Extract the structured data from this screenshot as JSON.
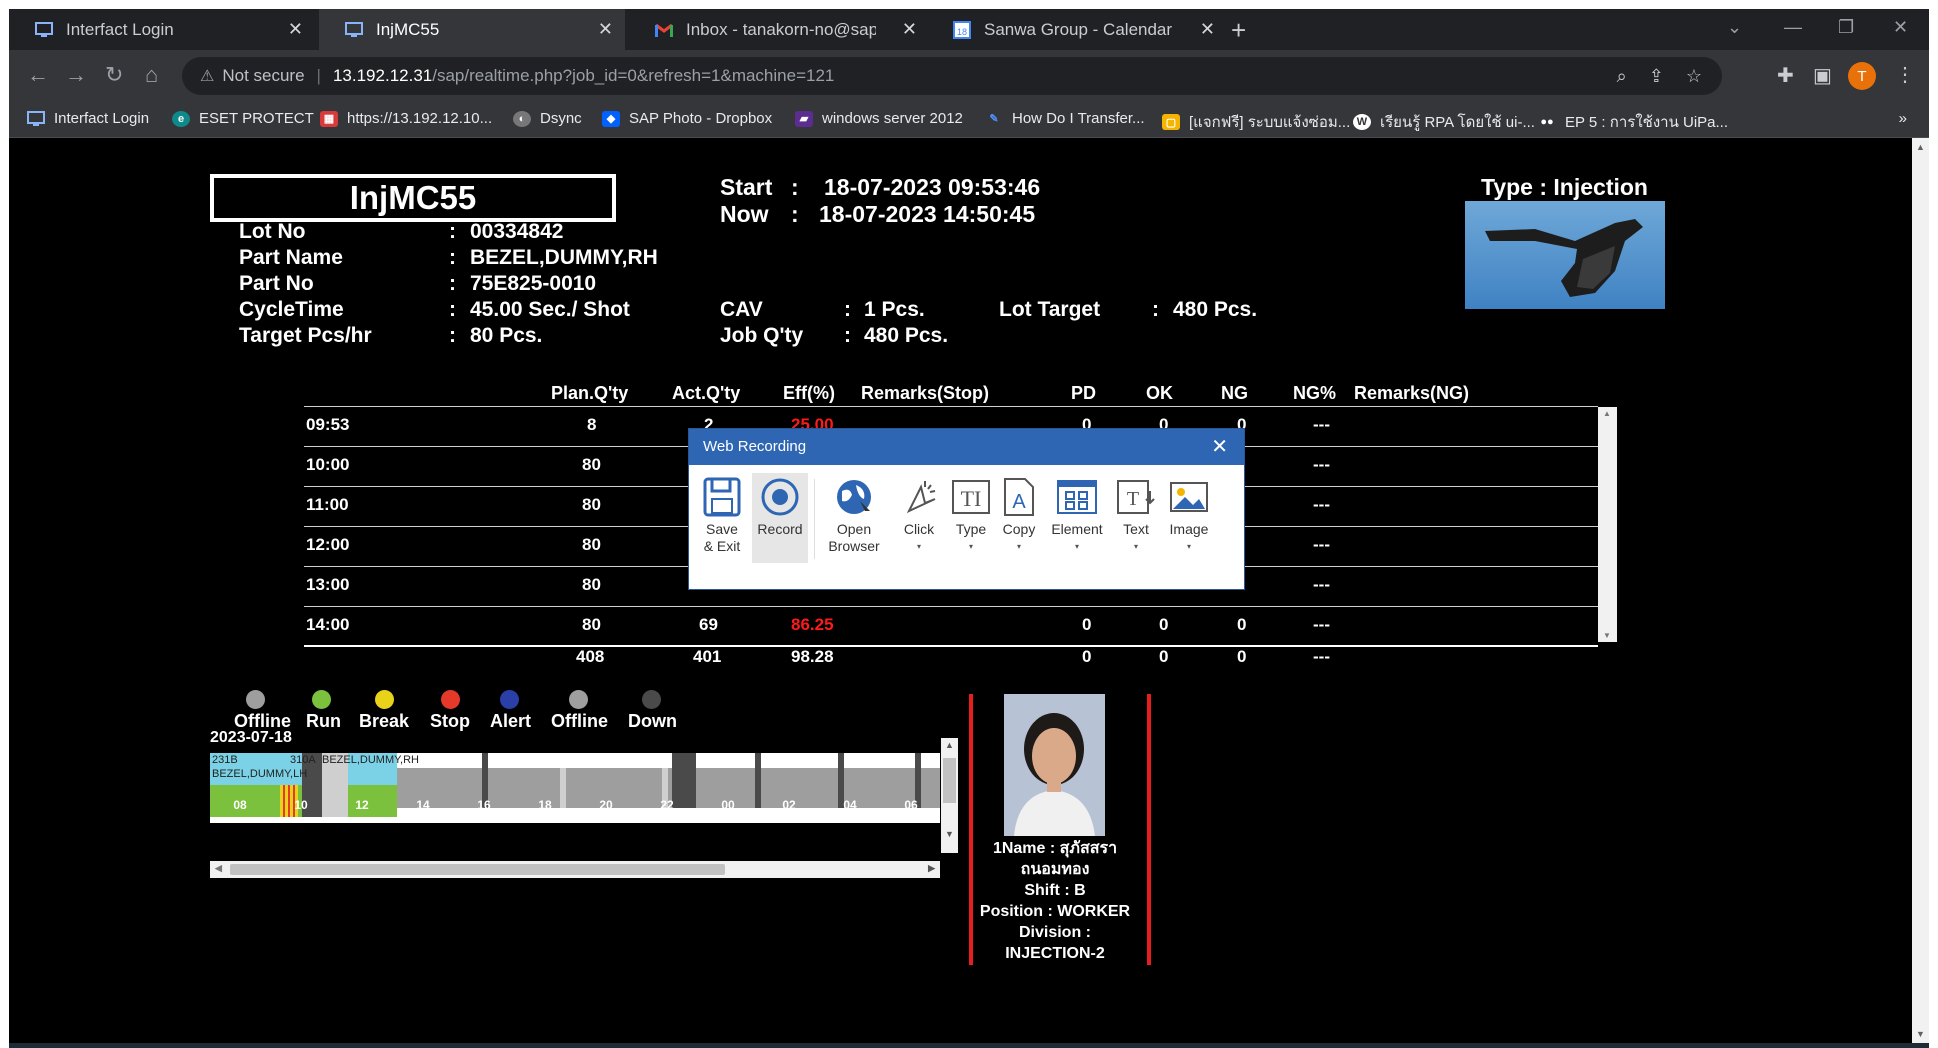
{
  "browser": {
    "tabs": [
      {
        "label": "Interfact Login",
        "active": false
      },
      {
        "label": "InjMC55",
        "active": true
      },
      {
        "label": "Inbox - tanakorn-no@sap.sanwa",
        "active": false
      },
      {
        "label": "Sanwa Group - Calendar - Week",
        "active": false
      }
    ],
    "address": {
      "security": "Not secure",
      "host": "13.192.12.31",
      "path": "/sap/realtime.php?job_id=0&refresh=1&machine=121"
    },
    "avatar_letter": "T",
    "bookmarks": [
      "Interfact Login",
      "ESET PROTECT",
      "https://13.192.12.10...",
      "Dsync",
      "SAP Photo - Dropbox",
      "windows server 2012",
      "How Do I Transfer...",
      "[แจกฟรี] ระบบแจ้งซ่อม...",
      "เรียนรู้ RPA โดยใช้ ui-...",
      "EP 5 : การใช้งาน UiPa..."
    ],
    "bookmarks_more": "»"
  },
  "machine": {
    "name": "InjMC55",
    "start_label": "Start",
    "start": "18-07-2023 09:53:46",
    "now_label": "Now",
    "now": "18-07-2023 14:50:45",
    "type_text": "Type : Injection",
    "lot_no_label": "Lot No",
    "lot_no": "00334842",
    "part_name_label": "Part Name",
    "part_name": "BEZEL,DUMMY,RH",
    "part_no_label": "Part No",
    "part_no": "75E825-0010",
    "cycle_label": "CycleTime",
    "cycle": "45.00 Sec./ Shot",
    "target_label": "Target Pcs/hr",
    "target": "80 Pcs.",
    "cav_label": "CAV",
    "cav": "1 Pcs.",
    "jobqty_label": "Job Q'ty",
    "jobqty": "480 Pcs.",
    "lot_target_label": "Lot Target",
    "lot_target": "480 Pcs.",
    "colon": ":"
  },
  "table": {
    "headers": [
      "Plan.Q'ty",
      "Act.Q'ty",
      "Eff(%)",
      "Remarks(Stop)",
      "PD",
      "OK",
      "NG",
      "NG%",
      "Remarks(NG)"
    ],
    "rows": [
      {
        "time": "09:53",
        "plan": "8",
        "act": "2",
        "eff": "25.00",
        "pd": "0",
        "ok": "0",
        "ng": "0",
        "ngp": "---"
      },
      {
        "time": "10:00",
        "plan": "80",
        "act": "",
        "eff": "",
        "pd": "",
        "ok": "",
        "ng": "",
        "ngp": "---"
      },
      {
        "time": "11:00",
        "plan": "80",
        "act": "",
        "eff": "",
        "pd": "",
        "ok": "",
        "ng": "",
        "ngp": "---"
      },
      {
        "time": "12:00",
        "plan": "80",
        "act": "",
        "eff": "",
        "pd": "",
        "ok": "",
        "ng": "",
        "ngp": "---"
      },
      {
        "time": "13:00",
        "plan": "80",
        "act": "",
        "eff": "",
        "pd": "",
        "ok": "",
        "ng": "",
        "ngp": "---"
      },
      {
        "time": "14:00",
        "plan": "80",
        "act": "69",
        "eff": "86.25",
        "pd": "0",
        "ok": "0",
        "ng": "0",
        "ngp": "---"
      }
    ],
    "total": {
      "plan": "408",
      "act": "401",
      "eff": "98.28",
      "pd": "0",
      "ok": "0",
      "ng": "0",
      "ngp": "---"
    }
  },
  "legend": [
    {
      "label": "Offline",
      "color": "#9e9e9e"
    },
    {
      "label": "Run",
      "color": "#7bc13d"
    },
    {
      "label": "Break",
      "color": "#e8d31a"
    },
    {
      "label": "Stop",
      "color": "#e53a2a"
    },
    {
      "label": "Alert",
      "color": "#2b3fa8"
    },
    {
      "label": "Offline",
      "color": "#9e9e9e"
    },
    {
      "label": "Down",
      "color": "#4a4a4a"
    }
  ],
  "timeline": {
    "date": "2023-07-18",
    "labels": [
      "231B",
      "310A",
      "BEZEL,DUMMY,RH",
      "BEZEL,DUMMY,LH"
    ],
    "ticks": [
      "08",
      "10",
      "12",
      "14",
      "16",
      "18",
      "20",
      "22",
      "00",
      "02",
      "04",
      "06"
    ]
  },
  "worker": {
    "name_line1": "1Name : สุภัสสรา",
    "name_line2": "ถนอมทอง",
    "shift": "Shift : B",
    "position": "Position : WORKER",
    "division": "Division :",
    "division_value": "INJECTION-2"
  },
  "dialog": {
    "title": "Web Recording",
    "buttons": [
      "Save & Exit",
      "Record",
      "Open Browser",
      "Click",
      "Type",
      "Copy",
      "Element",
      "Text",
      "Image"
    ]
  }
}
